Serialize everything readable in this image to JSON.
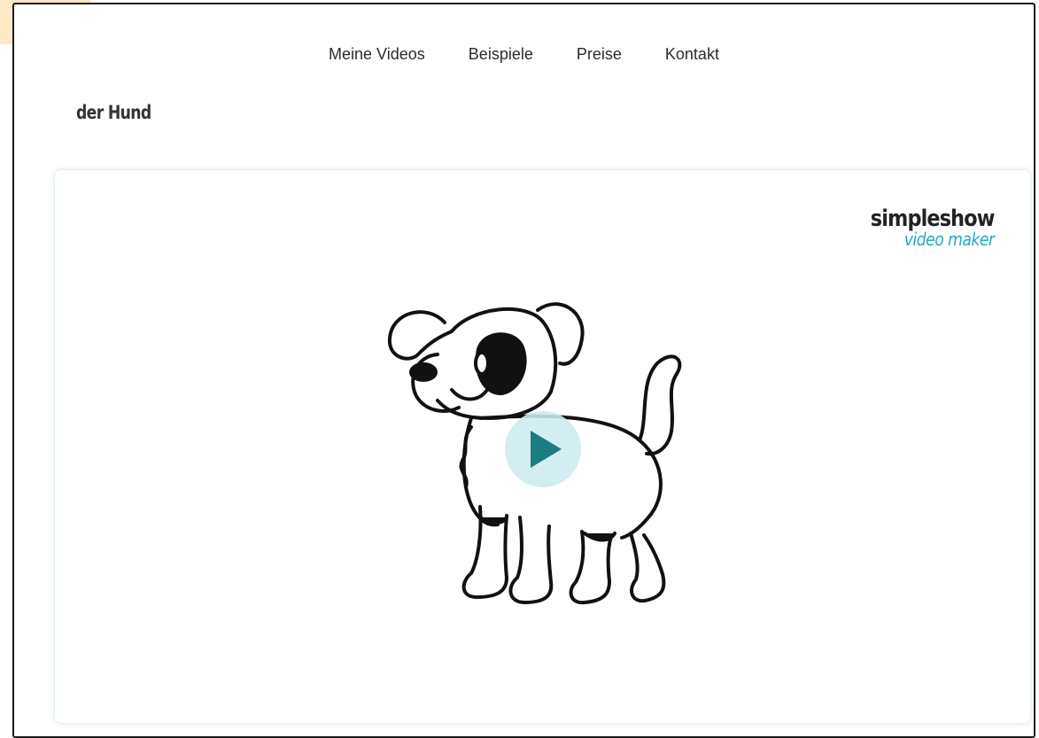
{
  "nav": {
    "items": [
      {
        "label": "Meine Videos"
      },
      {
        "label": "Beispiele"
      },
      {
        "label": "Preise"
      },
      {
        "label": "Kontakt"
      }
    ]
  },
  "page": {
    "title": "der Hund"
  },
  "video": {
    "brand_name": "simpleshow",
    "brand_sub": "video maker",
    "illustration": "cartoon-dog-icon",
    "play_icon": "play-icon",
    "colors": {
      "accent": "#1c7d80",
      "play_bg": "#cdecef",
      "brand_sub": "#2aa6c2"
    }
  }
}
